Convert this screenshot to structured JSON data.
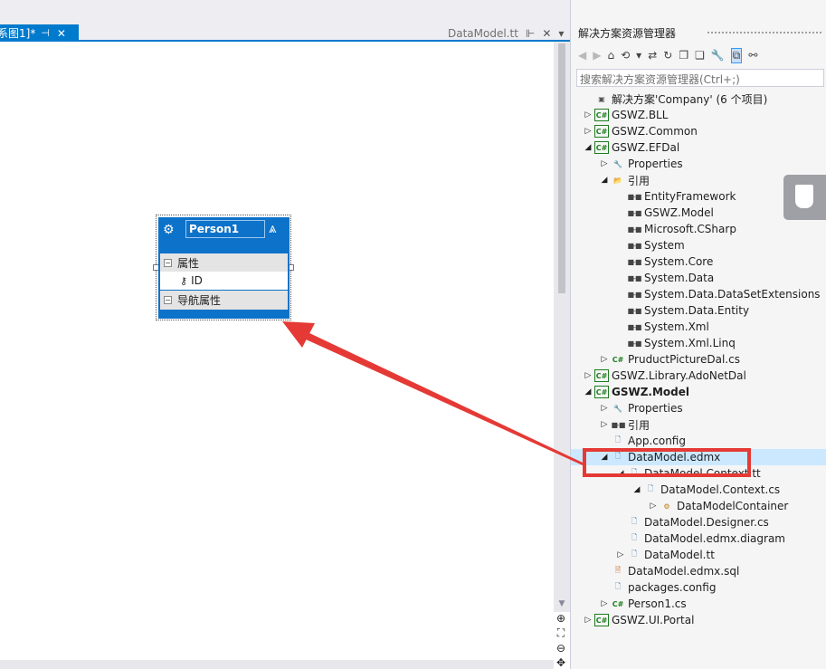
{
  "doc_tabs": {
    "active_label": "系图1]*",
    "active_pin": "⊣",
    "active_close": "✕",
    "inactive_label": "DataModel.tt",
    "inactive_icons": [
      "⊩",
      "✕"
    ],
    "dropdown": "▾"
  },
  "entity": {
    "name": "Person1",
    "section_properties": "属性",
    "property_id": "ID",
    "section_nav": "导航属性"
  },
  "solution_explorer": {
    "title": "解决方案资源管理器",
    "search_placeholder": "搜索解决方案资源管理器(Ctrl+;)",
    "toolbar": [
      "◀",
      "▶",
      "⌂",
      "⟲",
      "▾",
      "⇄",
      "↻",
      "❐",
      "❏",
      "🔧",
      "⧉",
      "⚯"
    ],
    "tree": [
      {
        "label": "解决方案'Company' (6 个项目)",
        "depth": 0,
        "icon": "sln",
        "toggle": ""
      },
      {
        "label": "GSWZ.BLL",
        "depth": 0,
        "icon": "cs",
        "toggle": "▷"
      },
      {
        "label": "GSWZ.Common",
        "depth": 0,
        "icon": "cs",
        "toggle": "▷"
      },
      {
        "label": "GSWZ.EFDal",
        "depth": 0,
        "icon": "cs",
        "toggle": "◢"
      },
      {
        "label": "Properties",
        "depth": 1,
        "icon": "wrench",
        "toggle": "▷"
      },
      {
        "label": "引用",
        "depth": 1,
        "icon": "folder",
        "toggle": "◢"
      },
      {
        "label": "EntityFramework",
        "depth": 2,
        "icon": "ref",
        "toggle": ""
      },
      {
        "label": "GSWZ.Model",
        "depth": 2,
        "icon": "ref",
        "toggle": ""
      },
      {
        "label": "Microsoft.CSharp",
        "depth": 2,
        "icon": "ref",
        "toggle": ""
      },
      {
        "label": "System",
        "depth": 2,
        "icon": "ref",
        "toggle": ""
      },
      {
        "label": "System.Core",
        "depth": 2,
        "icon": "ref",
        "toggle": ""
      },
      {
        "label": "System.Data",
        "depth": 2,
        "icon": "ref",
        "toggle": ""
      },
      {
        "label": "System.Data.DataSetExtensions",
        "depth": 2,
        "icon": "ref",
        "toggle": ""
      },
      {
        "label": "System.Data.Entity",
        "depth": 2,
        "icon": "ref",
        "toggle": ""
      },
      {
        "label": "System.Xml",
        "depth": 2,
        "icon": "ref",
        "toggle": ""
      },
      {
        "label": "System.Xml.Linq",
        "depth": 2,
        "icon": "ref",
        "toggle": ""
      },
      {
        "label": "PruductPictureDal.cs",
        "depth": 1,
        "icon": "csfile",
        "toggle": "▷"
      },
      {
        "label": "GSWZ.Library.AdoNetDal",
        "depth": 0,
        "icon": "cs",
        "toggle": "▷"
      },
      {
        "label": "GSWZ.Model",
        "depth": 0,
        "icon": "cs",
        "toggle": "◢",
        "bold": true
      },
      {
        "label": "Properties",
        "depth": 1,
        "icon": "wrench",
        "toggle": "▷"
      },
      {
        "label": "引用",
        "depth": 1,
        "icon": "ref",
        "toggle": "▷"
      },
      {
        "label": "App.config",
        "depth": 1,
        "icon": "page",
        "toggle": ""
      },
      {
        "label": "DataModel.edmx",
        "depth": 1,
        "icon": "page",
        "toggle": "◢",
        "selected": true
      },
      {
        "label": "DataModel.Context.tt",
        "depth": 2,
        "icon": "page",
        "toggle": "◢"
      },
      {
        "label": "DataModel.Context.cs",
        "depth": 3,
        "icon": "page",
        "toggle": "◢"
      },
      {
        "label": "DataModelContainer",
        "depth": 4,
        "icon": "cls",
        "toggle": "▷"
      },
      {
        "label": "DataModel.Designer.cs",
        "depth": 2,
        "icon": "page",
        "toggle": ""
      },
      {
        "label": "DataModel.edmx.diagram",
        "depth": 2,
        "icon": "page",
        "toggle": ""
      },
      {
        "label": "DataModel.tt",
        "depth": 2,
        "icon": "page",
        "toggle": "▷"
      },
      {
        "label": "DataModel.edmx.sql",
        "depth": 1,
        "icon": "sql",
        "toggle": ""
      },
      {
        "label": "packages.config",
        "depth": 1,
        "icon": "page",
        "toggle": ""
      },
      {
        "label": "Person1.cs",
        "depth": 1,
        "icon": "csfile",
        "toggle": "▷"
      },
      {
        "label": "GSWZ.UI.Portal",
        "depth": 0,
        "icon": "cs",
        "toggle": "▷"
      }
    ]
  },
  "zoom_tools": [
    "⊕",
    "⛶",
    "⊖",
    "✥"
  ],
  "colors": {
    "accent": "#007acc",
    "entity": "#0d72c9",
    "callout": "#e53935",
    "selection": "#cce8ff"
  }
}
